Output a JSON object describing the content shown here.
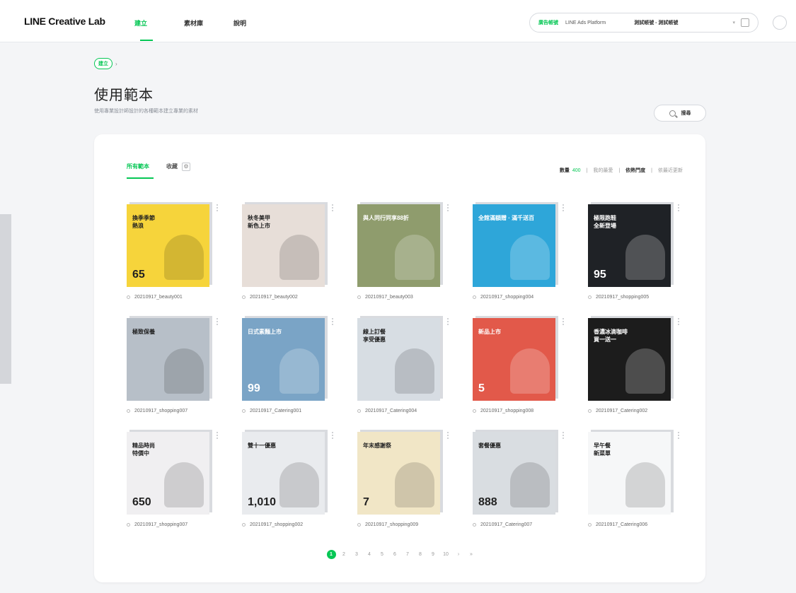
{
  "header": {
    "logo": "LINE Creative Lab",
    "nav": [
      "建立",
      "素材庫",
      "說明"
    ],
    "account": {
      "badge": "廣告帳號",
      "platform": "LINE Ads Platform",
      "name": "測試帳號 - 測試帳號"
    }
  },
  "breadcrumb": {
    "chip": "建立",
    "sep": "›"
  },
  "page": {
    "title": "使用範本",
    "description": "使用專業設計師設計的各種範本建立專業的素材",
    "search_label": "搜尋"
  },
  "tabs": {
    "all": "所有範本",
    "favorites": "收藏",
    "gear": "⚙"
  },
  "sort": {
    "count_label": "數量",
    "count_value": "400",
    "my_favs": "我的最愛",
    "popular": "依熱門度",
    "newest": "依最近更新"
  },
  "templates": [
    {
      "label": "20210917_beauty001",
      "bg": "#f6d43b",
      "text": "換季季節\n熱浪",
      "price": "65"
    },
    {
      "label": "20210917_beauty002",
      "bg": "#e7ded8",
      "text": "秋冬美甲\n新色上市",
      "price": ""
    },
    {
      "label": "20210917_beauty003",
      "bg": "#8f9c6d",
      "text": "與人同行同享88折",
      "price": ""
    },
    {
      "label": "20210917_shopping004",
      "bg": "#2ea6d9",
      "text": "全館滿額贈 · 滿千送百",
      "price": ""
    },
    {
      "label": "20210917_shopping005",
      "bg": "#1f2226",
      "text": "極限跑鞋\n全新登場",
      "price": "95"
    },
    {
      "label": "20210917_shopping007",
      "bg": "#b7bfc8",
      "text": "極致保養",
      "price": ""
    },
    {
      "label": "20210917_Catering001",
      "bg": "#7aa4c6",
      "text": "日式素麵上市",
      "price": "99"
    },
    {
      "label": "20210917_Catering004",
      "bg": "#d7dde3",
      "text": "線上訂餐\n享受優惠",
      "price": ""
    },
    {
      "label": "20210917_shopping008",
      "bg": "#e2594a",
      "text": "新品上市",
      "price": "5"
    },
    {
      "label": "20210917_Catering002",
      "bg": "#1c1c1c",
      "text": "香濃冰滴咖啡\n買一送一",
      "price": ""
    },
    {
      "label": "20210917_shopping007",
      "bg": "#f0eff1",
      "text": "精品時尚\n特價中",
      "price": "650"
    },
    {
      "label": "20210917_shopping002",
      "bg": "#e9ebee",
      "text": "雙十一優惠",
      "price": "1,010"
    },
    {
      "label": "20210917_shopping009",
      "bg": "#f1e6c6",
      "text": "年末感謝祭",
      "price": "7"
    },
    {
      "label": "20210917_Catering007",
      "bg": "#d9dde1",
      "text": "套餐優惠",
      "price": "888"
    },
    {
      "label": "20210917_Catering006",
      "bg": "#f6f7f8",
      "text": "早午餐\n新菜單",
      "price": ""
    }
  ],
  "pagination": [
    "1",
    "2",
    "3",
    "4",
    "5",
    "6",
    "7",
    "8",
    "9",
    "10",
    "›",
    "»"
  ],
  "colors": {
    "accent": "#06c755",
    "page_bg": "#f4f5f7",
    "card_bg": "#ffffff"
  }
}
